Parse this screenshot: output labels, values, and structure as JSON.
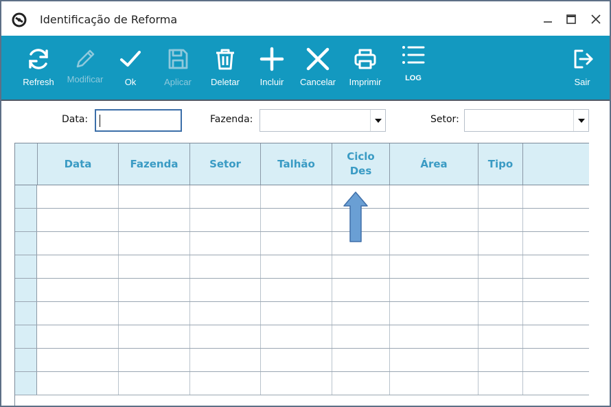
{
  "window": {
    "title": "Identificação de Reforma"
  },
  "toolbar": {
    "buttons": [
      {
        "label": "Refresh",
        "icon": "refresh-icon",
        "enabled": true
      },
      {
        "label": "Modificar",
        "icon": "pencil-icon",
        "enabled": false
      },
      {
        "label": "Ok",
        "icon": "check-icon",
        "enabled": true
      },
      {
        "label": "Aplicar",
        "icon": "save-icon",
        "enabled": false
      },
      {
        "label": "Deletar",
        "icon": "trash-icon",
        "enabled": true
      },
      {
        "label": "Incluir",
        "icon": "plus-icon",
        "enabled": true
      },
      {
        "label": "Cancelar",
        "icon": "close-icon",
        "enabled": true
      },
      {
        "label": "Imprimir",
        "icon": "printer-icon",
        "enabled": true
      },
      {
        "label": "LOG",
        "icon": "list-icon",
        "enabled": true
      },
      {
        "label": "Sair",
        "icon": "exit-icon",
        "enabled": true
      }
    ],
    "background": "#1399c0"
  },
  "filters": {
    "data_label": "Data:",
    "data_value": "",
    "fazenda_label": "Fazenda:",
    "fazenda_value": "",
    "setor_label": "Setor:",
    "setor_value": ""
  },
  "grid": {
    "columns": [
      "Data",
      "Fazenda",
      "Setor",
      "Talhão",
      "Ciclo Des",
      "Área",
      "Tipo",
      ""
    ],
    "rows": [
      [],
      [],
      [],
      [],
      [],
      [],
      [],
      [],
      []
    ],
    "header_color": "#3a9bc4",
    "header_background": "#d8eef6"
  },
  "annotation": {
    "icon": "arrow-up-icon",
    "color": "#6a9fd4"
  }
}
